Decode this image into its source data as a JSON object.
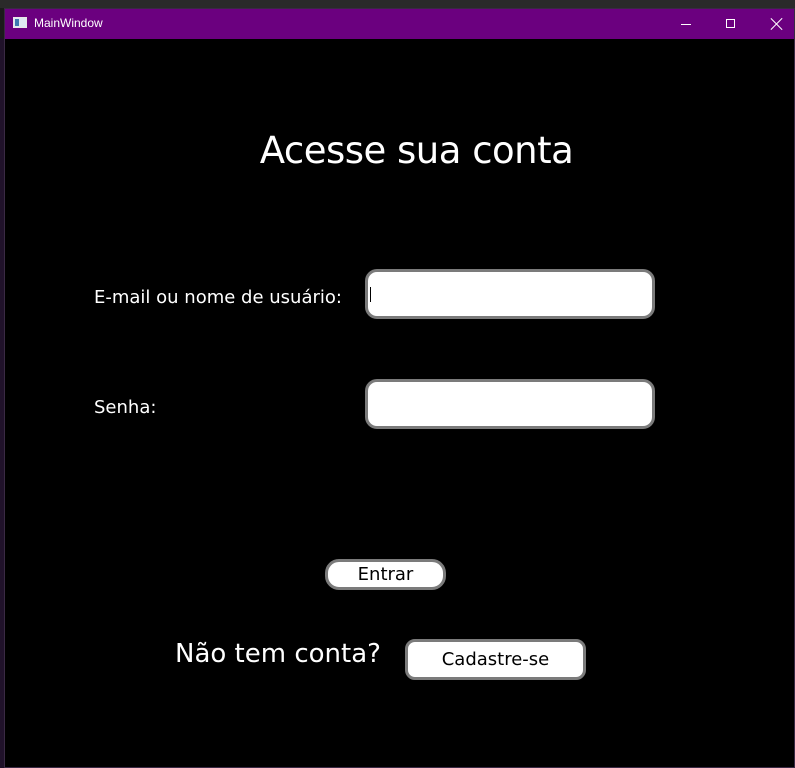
{
  "window": {
    "title": "MainWindow",
    "titlebar_color": "#6b007f",
    "background_color": "#000000",
    "controls": {
      "minimize_icon": "minimize-icon",
      "maximize_icon": "maximize-icon",
      "close_icon": "close-icon"
    }
  },
  "login": {
    "heading": "Acesse sua conta",
    "email_label": "E-mail ou nome de usuário:",
    "email_value": "",
    "password_label": "Senha:",
    "password_value": "",
    "submit_label": "Entrar",
    "signup_prompt": "Não tem conta?",
    "signup_label": "Cadastre-se"
  }
}
